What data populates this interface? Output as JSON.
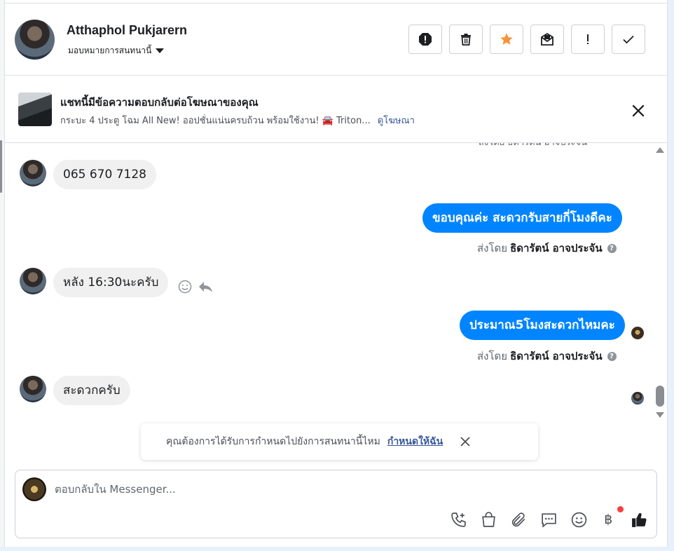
{
  "header": {
    "name": "Atthaphol Pukjarern",
    "assign_label": "มอบหมายการสนทนานี้"
  },
  "toolbar": {
    "buttons": [
      "spam-button",
      "delete-button",
      "star-button",
      "mark-unread-button",
      "important-button",
      "done-button"
    ]
  },
  "ad_banner": {
    "title": "แชทนี้มีข้อความตอบกลับต่อโฆษณาของคุณ",
    "subtitle": "กระบะ 4 ประตู โฉม All New! ออปชั่นแน่นครบถ้วน พร้อมใช้งาน! 🚘 Triton...",
    "link": "ดูโฆษณา"
  },
  "messages": [
    {
      "direction": "in",
      "text": "065 670 7128"
    },
    {
      "direction": "out",
      "text": "ขอบคุณค่ะ สะดวกรับสายกี่โมงดีคะ",
      "sent_by_prefix": "ส่งโดย",
      "sent_by_name": "ธิดารัตน์ อาจประจัน"
    },
    {
      "direction": "in",
      "text": "หลัง 16:30นะครับ"
    },
    {
      "direction": "out",
      "text": "ประมาณ5โมงสะดวกไหมคะ",
      "sent_by_prefix": "ส่งโดย",
      "sent_by_name": "ธิดารัตน์ อาจประจัน"
    },
    {
      "direction": "in",
      "text": "สะดวกครับ"
    }
  ],
  "toast": {
    "text": "คุณต้องการได้รับการกำหนดไปยังการสนทนานี้ไหม",
    "link": "กำหนดให้ฉัน"
  },
  "composer": {
    "placeholder": "ตอบกลับใน Messenger..."
  },
  "colors": {
    "accent": "#0084ff",
    "link": "#385898",
    "star": "#f7923b",
    "notification": "#fa3e3e"
  },
  "icons": [
    "phone-add-icon",
    "shopping-bag-icon",
    "paperclip-icon",
    "saved-reply-icon",
    "emoji-icon",
    "baht-payment-icon",
    "like-icon"
  ]
}
